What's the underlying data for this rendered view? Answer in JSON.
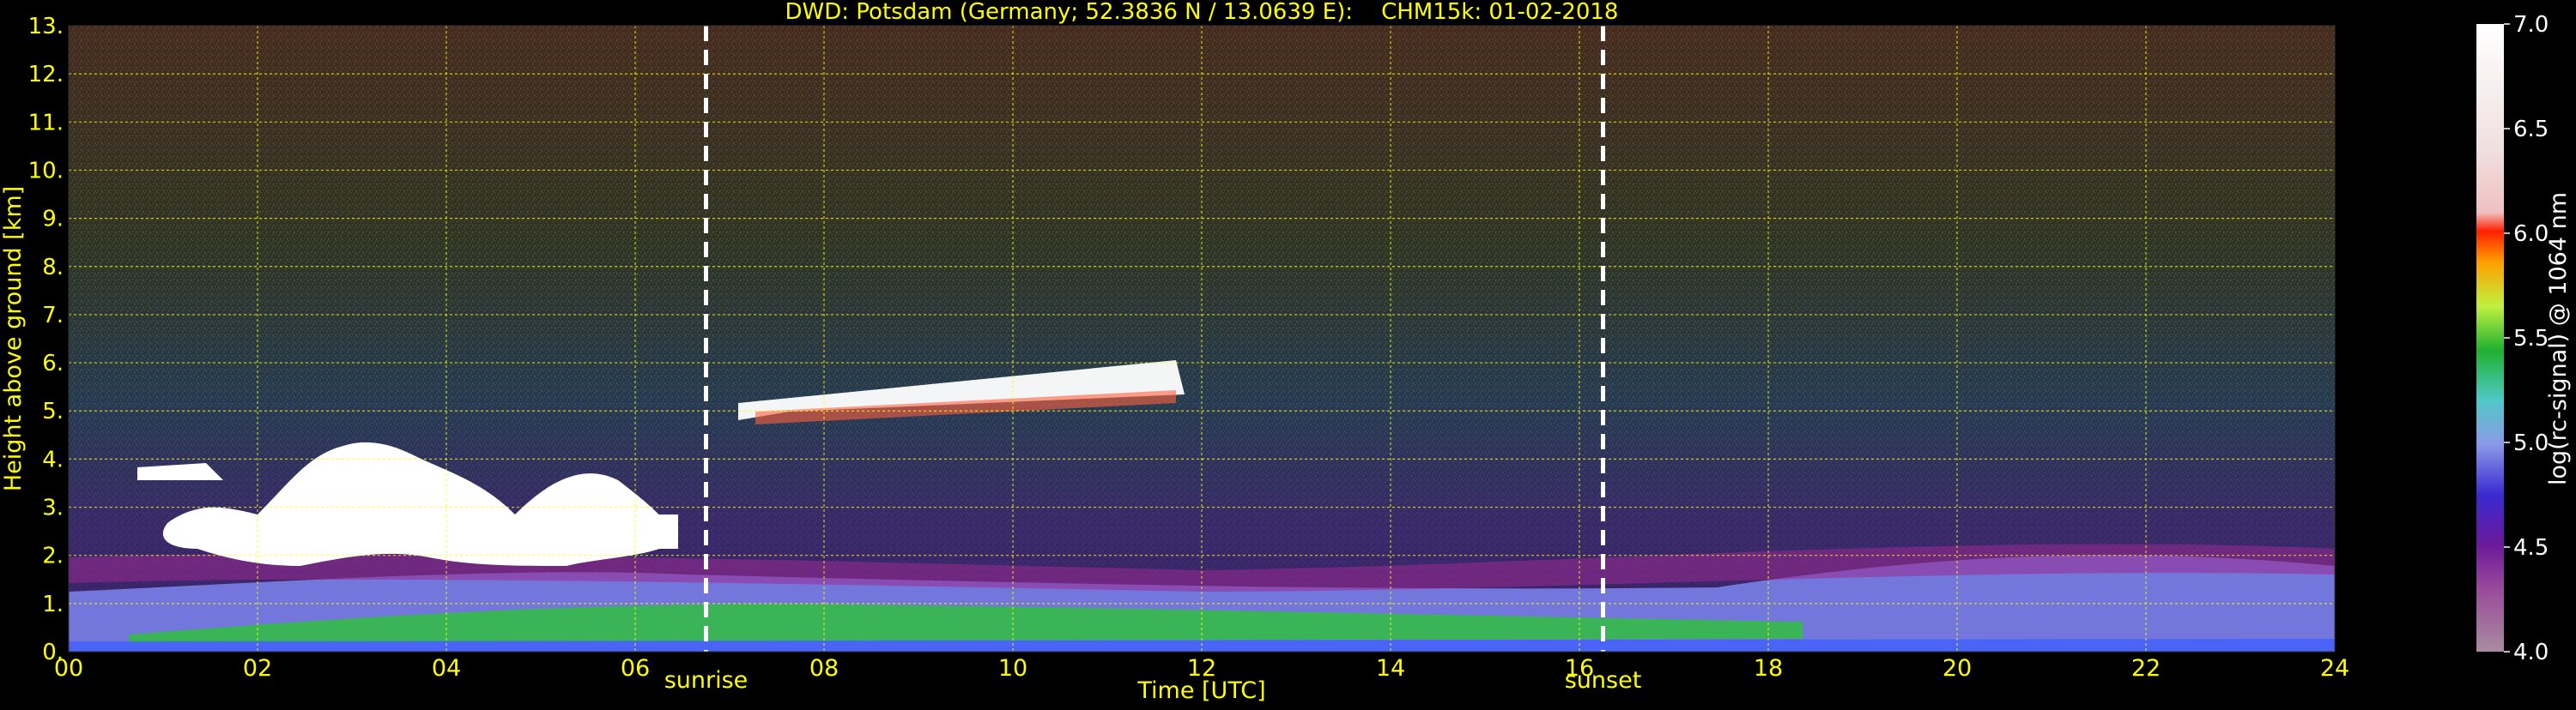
{
  "chart_data": {
    "type": "heatmap",
    "title": "DWD: Potsdam (Germany; 52.3836 N / 13.0639 E):    CHM15k: 01-02-2018",
    "xlabel": "Time [UTC]",
    "ylabel": "Height above ground [km]",
    "x_ticks": [
      "00",
      "02",
      "04",
      "06",
      "08",
      "10",
      "12",
      "14",
      "16",
      "18",
      "20",
      "22",
      "24"
    ],
    "xlim": [
      0,
      24
    ],
    "y_ticks": [
      "0.",
      "1.",
      "2.",
      "3.",
      "4.",
      "5.",
      "6.",
      "7.",
      "8.",
      "9.",
      "10.",
      "11.",
      "12.",
      "13."
    ],
    "ylim": [
      0,
      13
    ],
    "grid": true,
    "markers": [
      {
        "label": "sunrise",
        "time": 6.75
      },
      {
        "label": "sunset",
        "time": 16.25
      }
    ],
    "colorbar": {
      "label": "log(rc-signal) @ 1064 nm",
      "range": [
        4.0,
        7.0
      ],
      "ticks": [
        "4.0",
        "4.5",
        "5.0",
        "5.5",
        "6.0",
        "6.5",
        "7.0"
      ]
    },
    "colors": {
      "background": "#000000",
      "text": "#ffff00",
      "grid": "#ffff00",
      "colorbar_text": "#ffffff"
    }
  }
}
